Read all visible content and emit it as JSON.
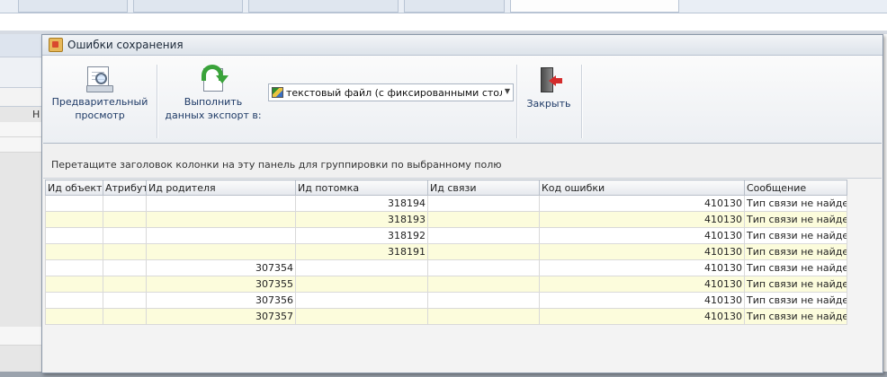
{
  "dialog": {
    "title": "Ошибки сохранения"
  },
  "ribbon": {
    "preview_label": [
      "Предварительный",
      "просмотр"
    ],
    "export_label": [
      "Выполнить",
      "данных экспорт в:"
    ],
    "export_format": "текстовый файл (с фиксированными столбцами)",
    "close_label": "Закрыть"
  },
  "background": {
    "left_header_letter": "Н"
  },
  "group_panel": {
    "hint": "Перетащите заголовок колонки на эту панель для группировки по выбранному полю"
  },
  "grid": {
    "columns": [
      "Ид объекта",
      "Атрибут",
      "Ид родителя",
      "Ид потомка",
      "Ид связи",
      "Код ошибки",
      "Сообщение"
    ],
    "rows": [
      [
        "",
        "",
        "",
        "318194",
        "",
        "410130",
        "Тип связи не найден."
      ],
      [
        "",
        "",
        "",
        "318193",
        "",
        "410130",
        "Тип связи не найден."
      ],
      [
        "",
        "",
        "",
        "318192",
        "",
        "410130",
        "Тип связи не найден."
      ],
      [
        "",
        "",
        "",
        "318191",
        "",
        "410130",
        "Тип связи не найден."
      ],
      [
        "",
        "",
        "307354",
        "",
        "",
        "410130",
        "Тип связи не найден."
      ],
      [
        "",
        "",
        "307355",
        "",
        "",
        "410130",
        "Тип связи не найден."
      ],
      [
        "",
        "",
        "307356",
        "",
        "",
        "410130",
        "Тип связи не найден."
      ],
      [
        "",
        "",
        "307357",
        "",
        "",
        "410130",
        "Тип связи не найден."
      ]
    ]
  },
  "colors": {
    "alt_row": "#fcfcdc",
    "link_text": "#1e3a66",
    "export_arrow": "#3aa33a",
    "close_arrow": "#d42b2b"
  },
  "icons": [
    "preview-icon",
    "export-icon",
    "text-format-icon",
    "close-door-icon"
  ]
}
